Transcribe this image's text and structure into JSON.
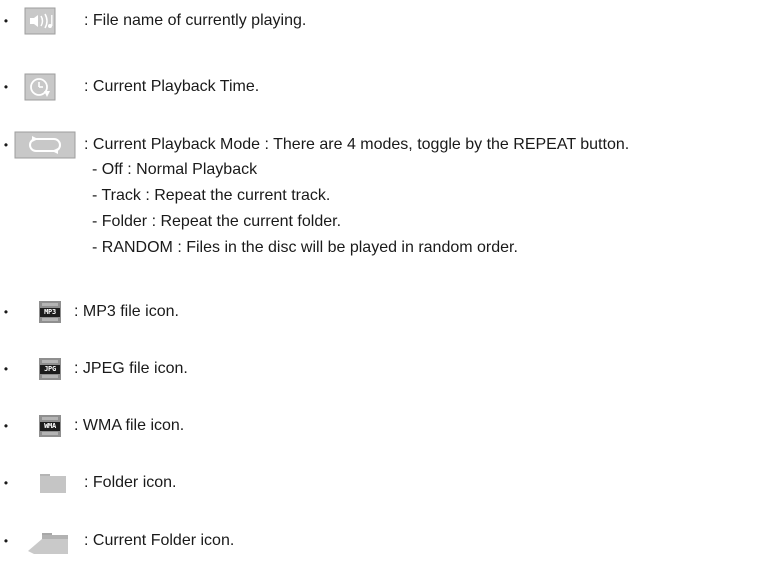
{
  "bullet": "•",
  "items": [
    {
      "icon": "speaker-note-icon",
      "text": ": File name of currently playing."
    },
    {
      "icon": "clock-icon",
      "text": ": Current Playback Time."
    },
    {
      "icon": "repeat-icon",
      "text": ": Current Playback Mode : There are 4 modes, toggle by the REPEAT button."
    },
    {
      "icon": "mp3-file-icon",
      "badge": "MP3",
      "text": ": MP3 file icon."
    },
    {
      "icon": "jpg-file-icon",
      "badge": "JPG",
      "text": ": JPEG file icon."
    },
    {
      "icon": "wma-file-icon",
      "badge": "WMA",
      "text": ": WMA file icon."
    },
    {
      "icon": "folder-icon",
      "text": ": Folder icon."
    },
    {
      "icon": "current-folder-icon",
      "text": ": Current Folder icon."
    }
  ],
  "modes": [
    "- Off : Normal Playback",
    "- Track : Repeat the current track.",
    "- Folder : Repeat the current folder.",
    "- RANDOM : Files in the disc will be played in random order."
  ],
  "colors": {
    "icon_gray": "#c6c6c6",
    "badge_gray": "#8f8f8f",
    "badge_dark": "#1d1d1d",
    "text": "#1a1a1a"
  }
}
